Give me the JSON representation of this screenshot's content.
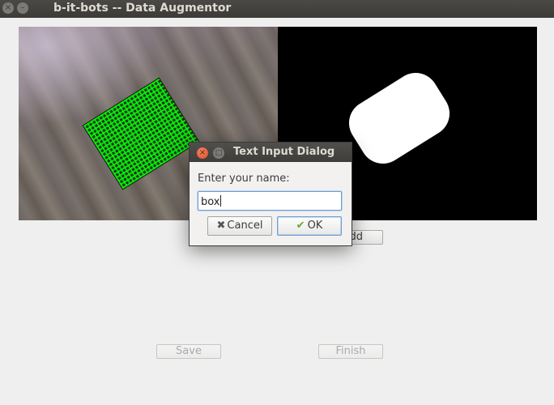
{
  "window": {
    "title": "b-it-bots -- Data Augmentor",
    "close_glyph": "×",
    "minimize_glyph": "–"
  },
  "panels": {
    "left": {
      "icon": "camera-image"
    },
    "right": {
      "icon": "segmentation-mask"
    }
  },
  "buttons": {
    "add_label": "Add",
    "save_label": "Save",
    "finish_label": "Finish"
  },
  "dialog": {
    "title": "Text Input Dialog",
    "prompt": "Enter your name:",
    "input_value": "box",
    "cancel_label": "Cancel",
    "ok_label": "OK",
    "close_glyph": "×",
    "max_glyph": "□",
    "cancel_icon": "✖",
    "ok_icon": "✔"
  },
  "colors": {
    "titlebar": "#3c3b37",
    "background": "#efefef",
    "close_button": "#dd4a23",
    "focus": "#6e9ed8",
    "overlay_green": "#00ff00"
  }
}
